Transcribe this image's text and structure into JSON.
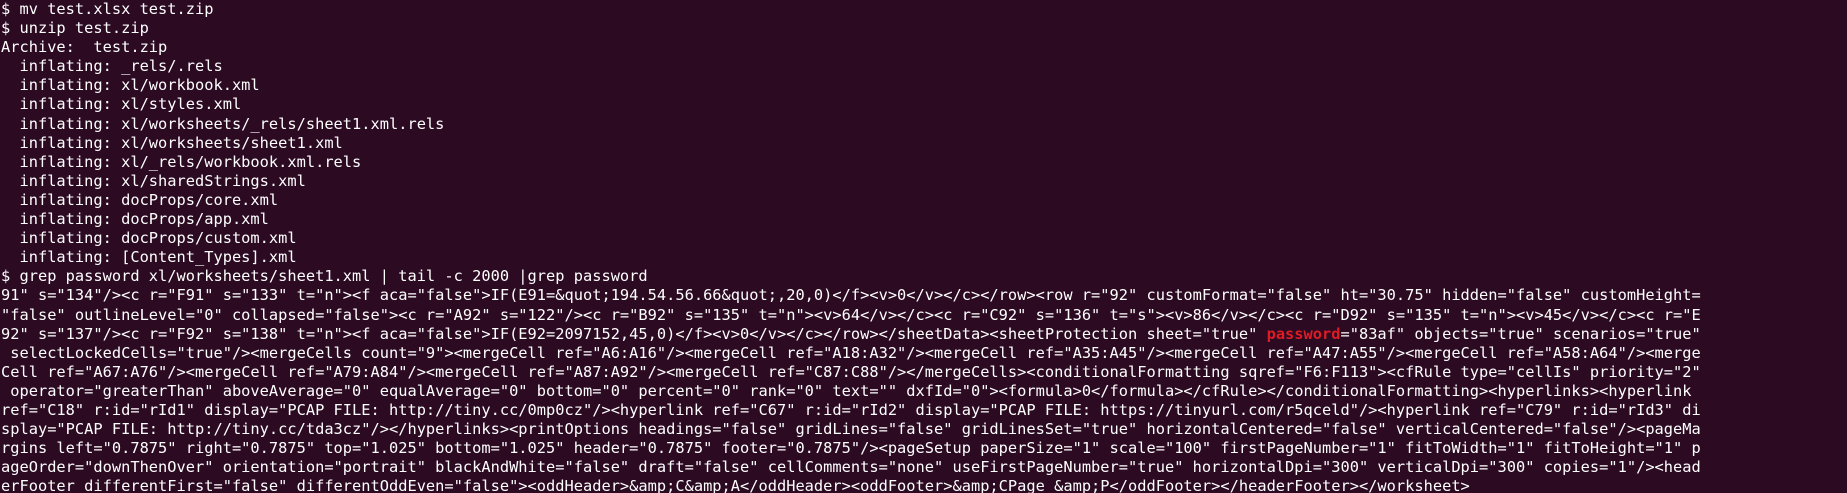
{
  "colors": {
    "background": "#2b0a22",
    "text": "#ffffff",
    "match_highlight": "#e01b24"
  },
  "terminal": {
    "lines": [
      "$ mv test.xlsx test.zip",
      "$ unzip test.zip",
      "Archive:  test.zip",
      "  inflating: _rels/.rels",
      "  inflating: xl/workbook.xml",
      "  inflating: xl/styles.xml",
      "  inflating: xl/worksheets/_rels/sheet1.xml.rels",
      "  inflating: xl/worksheets/sheet1.xml",
      "  inflating: xl/_rels/workbook.xml.rels",
      "  inflating: xl/sharedStrings.xml",
      "  inflating: docProps/core.xml",
      "  inflating: docProps/app.xml",
      "  inflating: docProps/custom.xml",
      "  inflating: [Content_Types].xml",
      "$ grep password xl/worksheets/sheet1.xml | tail -c 2000 |grep password",
      "91\" s=\"134\"/><c r=\"F91\" s=\"133\" t=\"n\"><f aca=\"false\">IF(E91=&quot;194.54.56.66&quot;,20,0)</f><v>0</v></c></row><row r=\"92\" customFormat=\"false\" ht=\"30.75\" hidden=\"false\" customHeight=",
      "\"false\" outlineLevel=\"0\" collapsed=\"false\"><c r=\"A92\" s=\"122\"/><c r=\"B92\" s=\"135\" t=\"n\"><v>64</v></c><c r=\"C92\" s=\"136\" t=\"s\"><v>86</v></c><c r=\"D92\" s=\"135\" t=\"n\"><v>45</v></c><c r=\"E",
      "92\" s=\"137\"/><c r=\"F92\" s=\"138\" t=\"n\"><f aca=\"false\">IF(E92=2097152,45,0)</f><v>0</v></c></row></sheetData><sheetProtection sheet=\"true\" ",
      " selectLockedCells=\"true\"/><mergeCells count=\"9\"><mergeCell ref=\"A6:A16\"/><mergeCell ref=\"A18:A32\"/><mergeCell ref=\"A35:A45\"/><mergeCell ref=\"A47:A55\"/><mergeCell ref=\"A58:A64\"/><merge",
      "Cell ref=\"A67:A76\"/><mergeCell ref=\"A79:A84\"/><mergeCell ref=\"A87:A92\"/><mergeCell ref=\"C87:C88\"/></mergeCells><conditionalFormatting sqref=\"F6:F113\"><cfRule type=\"cellIs\" priority=\"2\"",
      " operator=\"greaterThan\" aboveAverage=\"0\" equalAverage=\"0\" bottom=\"0\" percent=\"0\" rank=\"0\" text=\"\" dxfId=\"0\"><formula>0</formula></cfRule></conditionalFormatting><hyperlinks><hyperlink",
      "ref=\"C18\" r:id=\"rId1\" display=\"PCAP FILE: http://tiny.cc/0mp0cz\"/><hyperlink ref=\"C67\" r:id=\"rId2\" display=\"PCAP FILE: https://tinyurl.com/r5qceld\"/><hyperlink ref=\"C79\" r:id=\"rId3\" di",
      "splay=\"PCAP FILE: http://tiny.cc/tda3cz\"/></hyperlinks><printOptions headings=\"false\" gridLines=\"false\" gridLinesSet=\"true\" horizontalCentered=\"false\" verticalCentered=\"false\"/><pageMa",
      "rgins left=\"0.7875\" right=\"0.7875\" top=\"1.025\" bottom=\"1.025\" header=\"0.7875\" footer=\"0.7875\"/><pageSetup paperSize=\"1\" scale=\"100\" firstPageNumber=\"1\" fitToWidth=\"1\" fitToHeight=\"1\" p",
      "ageOrder=\"downThenOver\" orientation=\"portrait\" blackAndWhite=\"false\" draft=\"false\" cellComments=\"none\" useFirstPageNumber=\"true\" horizontalDpi=\"300\" verticalDpi=\"300\" copies=\"1\"/><head",
      "erFooter differentFirst=\"false\" differentOddEven=\"false\"><oddHeader>&amp;C&amp;A</oddHeader><oddFooter>&amp;CPage &amp;P</oddFooter></headerFooter></worksheet>"
    ],
    "highlighted": {
      "match": "password",
      "after_match": "=\"83af\" objects=\"true\" scenarios=\"true\""
    }
  }
}
